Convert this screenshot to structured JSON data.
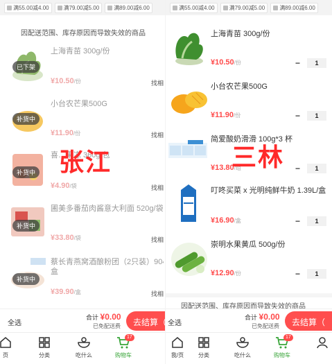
{
  "left": {
    "promo_tags": [
      "满55.00减4.00",
      "满79.00减5.00",
      "满89.00减6.00"
    ],
    "notice": "因配送范围、库存原因而导致失效的商品",
    "watermark": "张江",
    "items": [
      {
        "title": "上海青苗 300g/份",
        "price": "¥10.50",
        "unit": "/份",
        "badge": "已下架",
        "side": "找相"
      },
      {
        "title": "小台农芒果500G",
        "price": "¥11.90",
        "unit": "/份",
        "badge": "补货中",
        "side": "找相"
      },
      {
        "title": "喜…果冻 360g/包",
        "price": "¥4.90",
        "unit": "/袋",
        "badge": "补货中",
        "side": "找相"
      },
      {
        "title": "圃美多番茄肉酱意大利面 520g/袋",
        "price": "¥33.80",
        "unit": "/袋",
        "badge": "补货中",
        "side": "找相"
      },
      {
        "title": "蔡长青燕窝酒酿粉团（2只装）904",
        "title2": "盒",
        "price": "¥39.90",
        "unit": "/盒",
        "badge": "补货中",
        "side": "找相"
      }
    ],
    "checkout": {
      "select_all": "全选",
      "total_label": "合计",
      "total_value": "¥0.00",
      "delivery": "已免配送费",
      "pay": "去结算（"
    }
  },
  "right": {
    "promo_tags": [
      "满55.00减4.00",
      "满79.00减5.00",
      "满89.00减6.00"
    ],
    "notice": "因配送范围、库存原因而导致失效的商品",
    "watermark": "三林",
    "items": [
      {
        "title": "上海青苗 300g/份",
        "price": "¥10.50",
        "unit": "/份",
        "qty": "1"
      },
      {
        "title": "小台农芒果500G",
        "price": "¥11.90",
        "unit": "/份",
        "qty": "1"
      },
      {
        "title": "简爱酸奶滑滑 100g*3 杯",
        "price": "¥13.80",
        "unit": "/组",
        "qty": "1"
      },
      {
        "title": "叮咚买菜 x 光明纯鲜牛奶 1.39L/盒",
        "price": "¥16.90",
        "unit": "/盒",
        "qty": "1"
      },
      {
        "title": "崇明水果黄瓜 500g/份",
        "price": "¥12.90",
        "unit": "/份",
        "qty": "1"
      }
    ],
    "checkout": {
      "select_all": "全选",
      "total_label": "合计",
      "total_value": "¥0.00",
      "delivery": "已免配送费",
      "pay": "去结算（"
    }
  },
  "tabbar": {
    "left_tabs": [
      "页",
      "分类",
      "吃什么",
      "购物车"
    ],
    "right_tabs": [
      "我/页",
      "分类",
      "吃什么",
      "购物车"
    ],
    "cart_count": "17"
  },
  "colors": {
    "accent_red": "#ff4a4a",
    "active_green": "#3aa53a",
    "watermark_red": "#ff2a2a"
  }
}
